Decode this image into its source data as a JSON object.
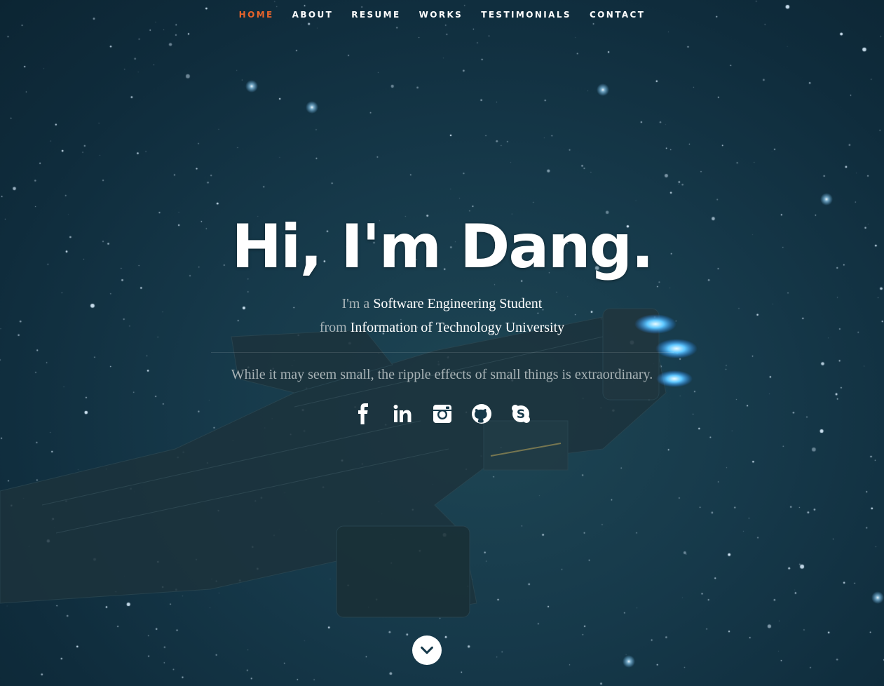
{
  "nav": {
    "items": [
      {
        "label": "HOME",
        "current": true
      },
      {
        "label": "ABOUT",
        "current": false
      },
      {
        "label": "RESUME",
        "current": false
      },
      {
        "label": "WORKS",
        "current": false
      },
      {
        "label": "TESTIMONIALS",
        "current": false
      },
      {
        "label": "CONTACT",
        "current": false
      }
    ],
    "accent_color": "#e8642b"
  },
  "hero": {
    "headline": "Hi, I'm Dang.",
    "line1_prefix": "I'm a",
    "line1_highlight": "Software Engineering Student",
    "line2_prefix": "from",
    "line2_highlight": "Information of Technology University",
    "tagline": "While it may seem small, the ripple effects of small things is extraordinary."
  },
  "social": [
    {
      "icon": "facebook-icon"
    },
    {
      "icon": "linkedin-icon"
    },
    {
      "icon": "instagram-icon"
    },
    {
      "icon": "github-icon"
    },
    {
      "icon": "skype-icon"
    }
  ],
  "scroll": {
    "icon": "chevron-down-icon"
  }
}
